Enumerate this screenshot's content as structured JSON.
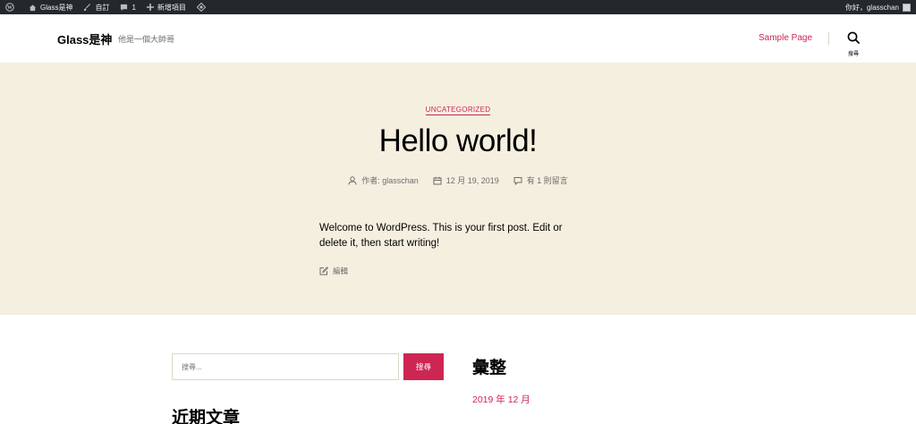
{
  "adminbar": {
    "site_name": "Glass是神",
    "customize": "自訂",
    "comments_count": "1",
    "new_item": "新增項目",
    "greeting": "你好，glasschan"
  },
  "header": {
    "site_title": "Glass是神",
    "site_description": "他是一個大帥哥",
    "nav_items": [
      "Sample Page"
    ],
    "search_label": "搜尋"
  },
  "post": {
    "category": "UNCATEGORIZED",
    "title": "Hello world!",
    "author": "作者: glasschan",
    "date": "12 月 19, 2019",
    "comments": "有 1 則留言",
    "content": "Welcome to WordPress. This is your first post. Edit or delete it, then start writing!",
    "edit_label": "編輯"
  },
  "widgets": {
    "search_placeholder": "搜尋...",
    "search_button": "搜尋",
    "archive_title": "彙整",
    "archive_items": [
      "2019 年 12 月"
    ],
    "recent_title": "近期文章"
  },
  "colors": {
    "accent": "#cd2653",
    "hero_bg": "#f5efe0",
    "adminbar_bg": "#23282d"
  }
}
